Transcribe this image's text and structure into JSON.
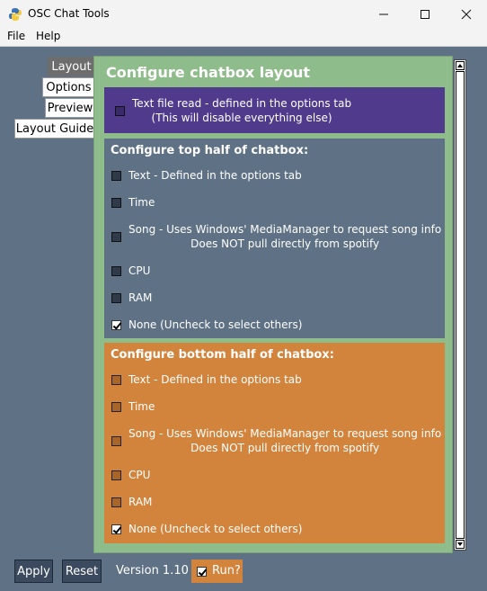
{
  "window": {
    "title": "OSC Chat Tools"
  },
  "menu": [
    "File",
    "Help"
  ],
  "tabs": [
    "Layout",
    "Options",
    "Preview",
    "Layout Guide"
  ],
  "panel": {
    "title": "Configure chatbox layout",
    "file_read": {
      "line1": "Text file read - defined in the options tab",
      "line2": "(This will disable everything else)",
      "checked": false
    },
    "top": {
      "title": "Configure top half of chatbox:",
      "items": [
        {
          "line1": "Text - Defined in the options tab",
          "line2": "",
          "checked": false
        },
        {
          "line1": "Time",
          "line2": "",
          "checked": false
        },
        {
          "line1": "Song - Uses Windows' MediaManager to request song info",
          "line2": "Does NOT pull directly from spotify",
          "checked": false
        },
        {
          "line1": "CPU",
          "line2": "",
          "checked": false
        },
        {
          "line1": "RAM",
          "line2": "",
          "checked": false
        },
        {
          "line1": "None (Uncheck to select others)",
          "line2": "",
          "checked": true
        }
      ]
    },
    "bottom": {
      "title": "Configure bottom half of chatbox:",
      "items": [
        {
          "line1": "Text - Defined in the options tab",
          "line2": "",
          "checked": false
        },
        {
          "line1": "Time",
          "line2": "",
          "checked": false
        },
        {
          "line1": "Song - Uses Windows' MediaManager to request song info",
          "line2": "Does NOT pull directly from spotify",
          "checked": false
        },
        {
          "line1": "CPU",
          "line2": "",
          "checked": false
        },
        {
          "line1": "RAM",
          "line2": "",
          "checked": false
        },
        {
          "line1": "None (Uncheck to select others)",
          "line2": "",
          "checked": true
        }
      ]
    }
  },
  "footer": {
    "apply": "Apply",
    "reset": "Reset",
    "version": "Version 1.10",
    "run": "Run?",
    "run_checked": true
  }
}
